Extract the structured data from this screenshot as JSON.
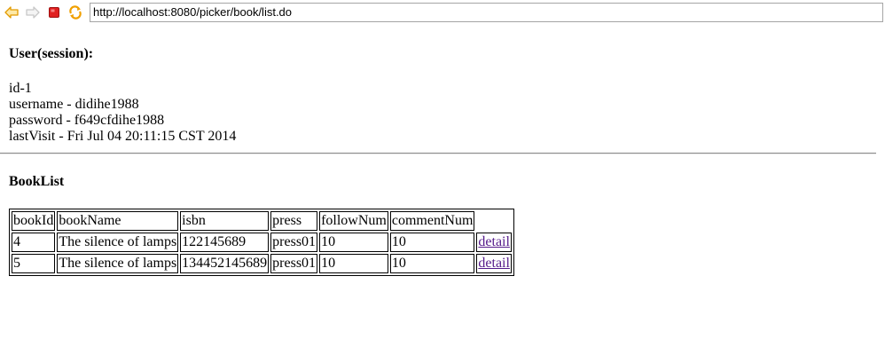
{
  "browser": {
    "url": "http://localhost:8080/picker/book/list.do",
    "icons": [
      "back-arrow-icon",
      "forward-arrow-icon",
      "stop-icon",
      "refresh-icon"
    ]
  },
  "user": {
    "heading": "User(session):",
    "id": "id-1",
    "username": "username - didihe1988",
    "password": "password - f649cfdihe1988",
    "last_visit": "lastVisit - Fri Jul 04 20:11:15 CST 2014"
  },
  "books": {
    "heading": "BookList",
    "columns": [
      "bookId",
      "bookName",
      "isbn",
      "press",
      "followNum",
      "commentNum"
    ],
    "rows": [
      {
        "bookId": "4",
        "bookName": "The silence of lamps",
        "isbn": "122145689",
        "press": "press01",
        "followNum": "10",
        "commentNum": "10",
        "link": "detail"
      },
      {
        "bookId": "5",
        "bookName": "The silence of lamps",
        "isbn": "134452145689",
        "press": "press01",
        "followNum": "10",
        "commentNum": "10",
        "link": "detail"
      }
    ]
  },
  "colors": {
    "link_visited": "#551a8b",
    "icon_orange": "#f0a000",
    "stop_red": "#e02020"
  }
}
